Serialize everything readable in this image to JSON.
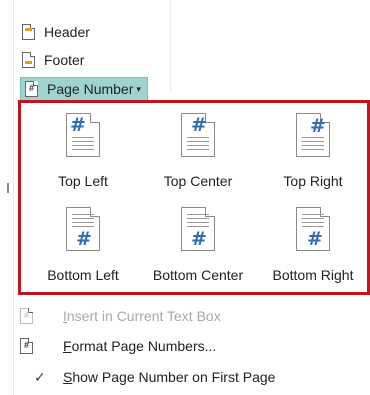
{
  "ribbon": {
    "header_label": "Header",
    "footer_label": "Footer",
    "page_number_label": "Page Number",
    "page_number_caret": "▾"
  },
  "gallery": {
    "items": [
      {
        "label": "Top Left",
        "hash": "#"
      },
      {
        "label": "Top Center",
        "hash": "#"
      },
      {
        "label": "Top Right",
        "hash": "#"
      },
      {
        "label": "Bottom Left",
        "hash": "#"
      },
      {
        "label": "Bottom Center",
        "hash": "#"
      },
      {
        "label": "Bottom Right",
        "hash": "#"
      }
    ]
  },
  "menu": {
    "insert_current_text_box": {
      "first": "I",
      "rest": "nsert in Current Text Box"
    },
    "format_page_numbers": {
      "first": "F",
      "rest": "ormat Page Numbers..."
    },
    "show_on_first_page": {
      "first": "S",
      "rest": "how Page Number on First Page",
      "check": "✓"
    }
  },
  "colors": {
    "accent_hash": "#2d6db5",
    "highlight_border": "#c0141e",
    "page_number_bg": "#9fd3cf",
    "header_band": "#e0a020"
  }
}
